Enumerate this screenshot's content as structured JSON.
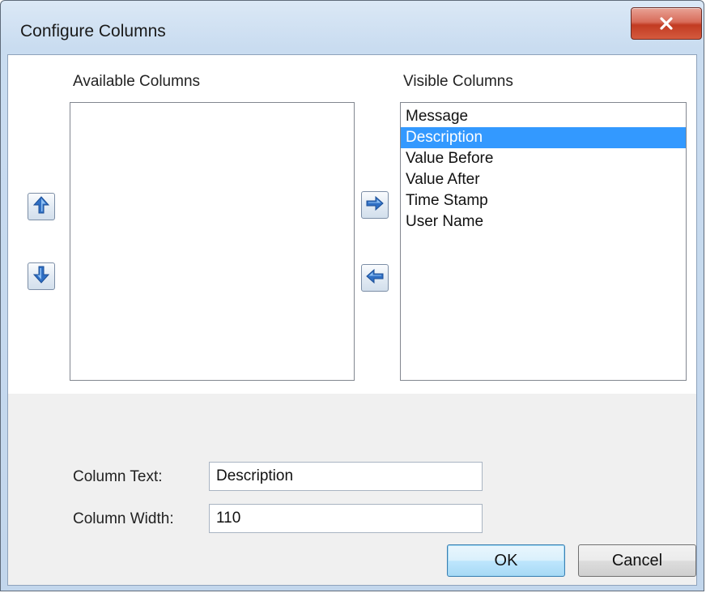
{
  "window": {
    "title": "Configure Columns",
    "close_icon": "close-x-icon"
  },
  "available": {
    "label": "Available Columns",
    "items": []
  },
  "visible": {
    "label": "Visible Columns",
    "items": [
      "Message",
      "Description",
      "Value Before",
      "Value After",
      "Time Stamp",
      "User Name"
    ],
    "selected_index": 1
  },
  "buttons": {
    "move_up_icon": "arrow-up-icon",
    "move_down_icon": "arrow-down-icon",
    "add_icon": "arrow-right-icon",
    "remove_icon": "arrow-left-icon",
    "ok": "OK",
    "cancel": "Cancel"
  },
  "fields": {
    "column_text_label": "Column Text:",
    "column_text_value": "Description",
    "column_width_label": "Column Width:",
    "column_width_value": "110"
  },
  "colors": {
    "selection": "#3399ff",
    "arrow_blue": "#2f6fc4",
    "close_red": "#c23b22"
  }
}
